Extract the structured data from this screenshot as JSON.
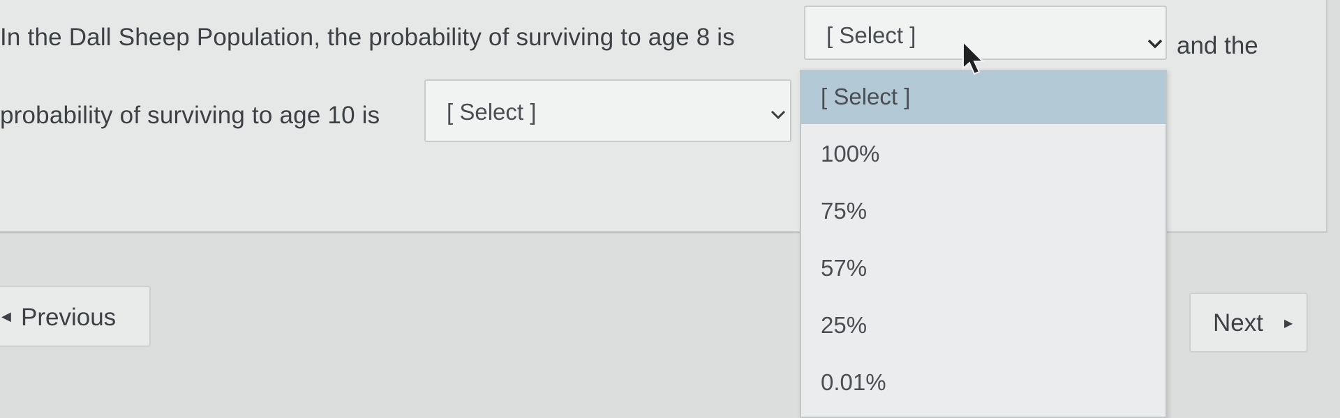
{
  "question": {
    "line1_text": "In the Dall Sheep Population, the probability of surviving to age 8 is",
    "line1_tail": "and the",
    "line2_text": "probability of surviving to age 10 is"
  },
  "select_age8": {
    "value": "[ Select ]",
    "icon": "chevron-down-icon"
  },
  "select_age10": {
    "value": "[ Select ]",
    "icon": "chevron-down-icon"
  },
  "dropdown": {
    "highlighted": "[ Select ]",
    "options": [
      "[ Select ]",
      "100%",
      "75%",
      "57%",
      "25%",
      "0.01%"
    ]
  },
  "nav": {
    "previous_label": "Previous",
    "previous_icon": "triangle-left-icon",
    "next_label": "Next",
    "next_icon": "triangle-right-icon"
  },
  "colors": {
    "background": "#dcdedd",
    "highlight": "#b3c9d6",
    "text": "#3d4044"
  }
}
